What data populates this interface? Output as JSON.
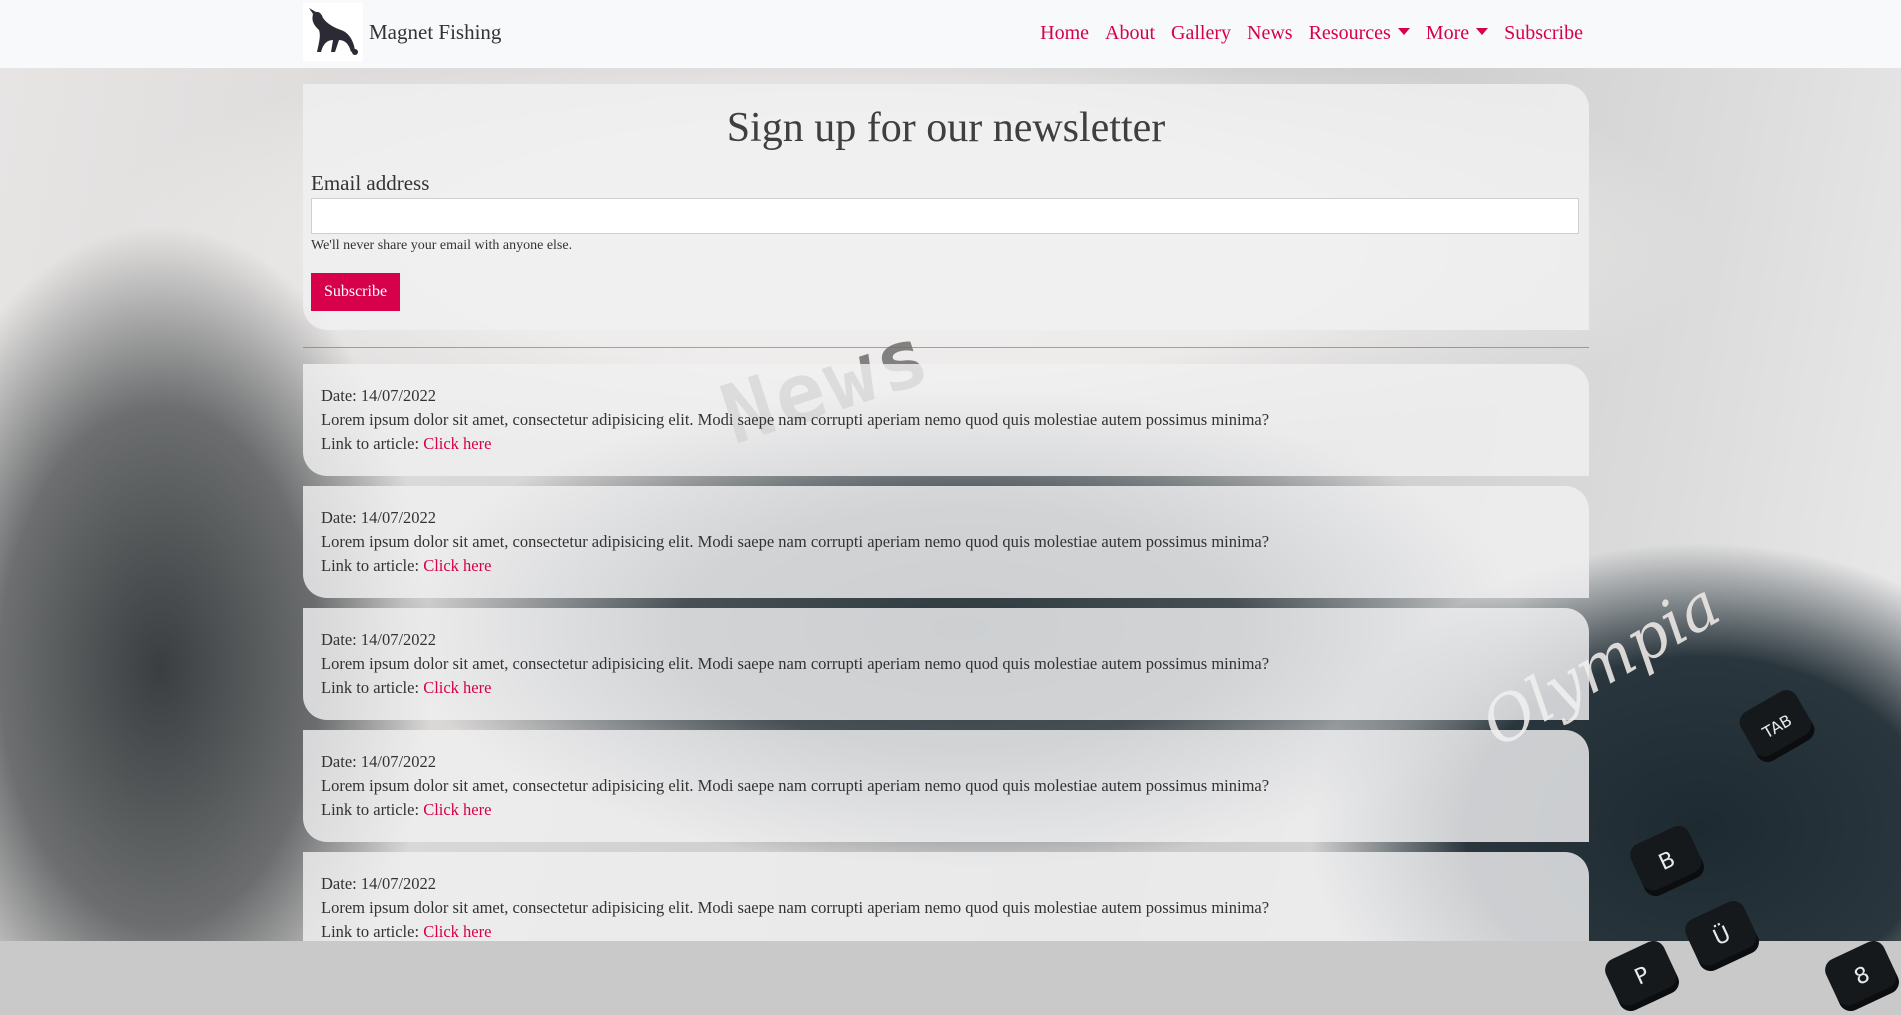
{
  "navbar": {
    "brand_name": "Magnet Fishing",
    "links": [
      {
        "label": "Home"
      },
      {
        "label": "About"
      },
      {
        "label": "Gallery"
      },
      {
        "label": "News"
      },
      {
        "label": "Resources",
        "dropdown": true
      },
      {
        "label": "More",
        "dropdown": true
      },
      {
        "label": "Subscribe"
      }
    ]
  },
  "background": {
    "printed_word": "News",
    "typewriter_brand": "Olympia",
    "key_labels": [
      "TAB",
      "B",
      "Ü",
      "P",
      "8"
    ]
  },
  "newsletter": {
    "heading": "Sign up for our newsletter",
    "email_label": "Email address",
    "email_value": "",
    "help_text": "We'll never share your email with anyone else.",
    "submit_label": "Subscribe"
  },
  "articles": [
    {
      "date_text": "Date: 14/07/2022",
      "body": "Lorem ipsum dolor sit amet, consectetur adipisicing elit. Modi saepe nam corrupti aperiam nemo quod quis molestiae autem possimus minima?",
      "link_prefix": "Link to article: ",
      "link_label": "Click here"
    },
    {
      "date_text": "Date: 14/07/2022",
      "body": "Lorem ipsum dolor sit amet, consectetur adipisicing elit. Modi saepe nam corrupti aperiam nemo quod quis molestiae autem possimus minima?",
      "link_prefix": "Link to article: ",
      "link_label": "Click here"
    },
    {
      "date_text": "Date: 14/07/2022",
      "body": "Lorem ipsum dolor sit amet, consectetur adipisicing elit. Modi saepe nam corrupti aperiam nemo quod quis molestiae autem possimus minima?",
      "link_prefix": "Link to article: ",
      "link_label": "Click here"
    },
    {
      "date_text": "Date: 14/07/2022",
      "body": "Lorem ipsum dolor sit amet, consectetur adipisicing elit. Modi saepe nam corrupti aperiam nemo quod quis molestiae autem possimus minima?",
      "link_prefix": "Link to article: ",
      "link_label": "Click here"
    },
    {
      "date_text": "Date: 14/07/2022",
      "body": "Lorem ipsum dolor sit amet, consectetur adipisicing elit. Modi saepe nam corrupti aperiam nemo quod quis molestiae autem possimus minima?",
      "link_prefix": "Link to article: ",
      "link_label": "Click here"
    }
  ],
  "colors": {
    "accent": "#d6004b",
    "navbar_bg": "#f8f9fa",
    "panel_bg": "#f0f0f1"
  }
}
